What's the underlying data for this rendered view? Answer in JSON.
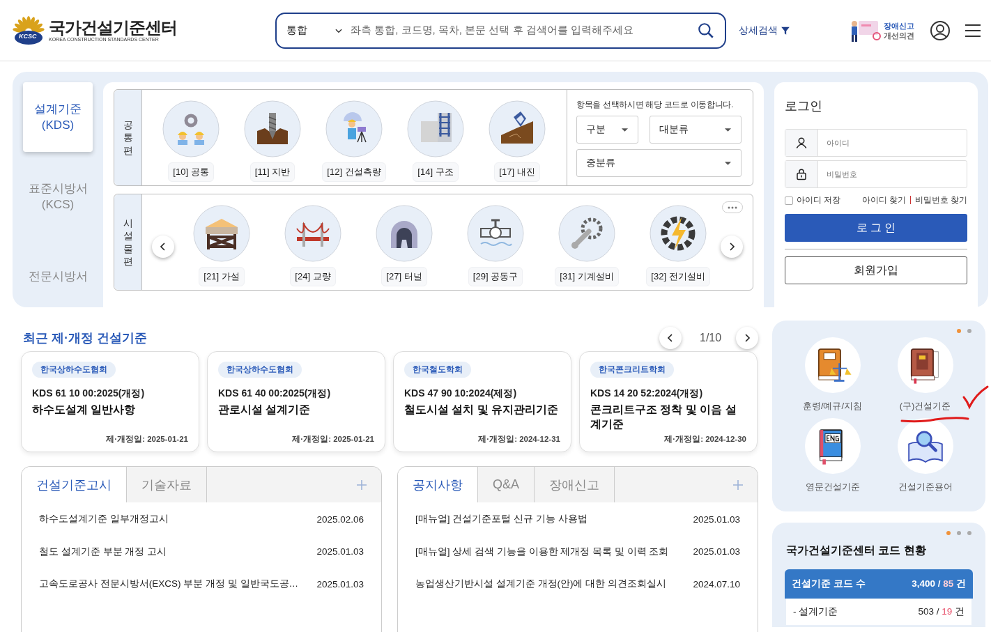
{
  "header": {
    "logo": {
      "mark": "KCSC",
      "name": "국가건설기준센터",
      "subtitle": "KOREA CONSTRUCTION STANDARDS CENTER"
    },
    "search": {
      "scope": "통합",
      "placeholder": "좌측 통합, 코드명, 목차, 본문 선택 후 검색어를 입력해주세요"
    },
    "detail_search": "상세검색",
    "report": [
      "장애신고",
      "개선의견"
    ]
  },
  "category_tabs": [
    {
      "label": "설계기준 (KDS)",
      "selected": true
    },
    {
      "label": "표준시방서 (KCS)",
      "selected": false
    },
    {
      "label": "전문시방서",
      "selected": false
    }
  ],
  "groups": [
    {
      "title": "공통편",
      "items": [
        {
          "code": "[10] 공통"
        },
        {
          "code": "[11] 지반"
        },
        {
          "code": "[12] 건설측량"
        },
        {
          "code": "[14] 구조"
        },
        {
          "code": "[17] 내진"
        }
      ]
    },
    {
      "title": "시설물편",
      "items": [
        {
          "code": "[21] 가설"
        },
        {
          "code": "[24] 교량"
        },
        {
          "code": "[27] 터널"
        },
        {
          "code": "[29] 공동구"
        },
        {
          "code": "[31] 기계설비"
        },
        {
          "code": "[32] 전기설비"
        }
      ]
    }
  ],
  "selector": {
    "hint": "항목을 선택하시면 해당 코드로 이동합니다.",
    "selects": [
      "구분",
      "대분류",
      "중분류"
    ]
  },
  "login": {
    "title": "로그인",
    "id_placeholder": "아이디",
    "pw_placeholder": "비밀번호",
    "remember": {
      "label": "아이디 저장",
      "checked": false
    },
    "links": [
      "아이디 찾기",
      "비밀번호 찾기"
    ],
    "login_button": "로 그 인",
    "join_button": "회원가입"
  },
  "recent": {
    "title": "최근 제·개정 건설기준",
    "page": "1/10",
    "cards": [
      {
        "org": "한국상하수도협회",
        "code": "KDS 61 10 00:2025(개정)",
        "title": "하수도설계 일반사항",
        "date": "제·개정일: 2025-01-21"
      },
      {
        "org": "한국상하수도협회",
        "code": "KDS 61 40 00:2025(개정)",
        "title": "관로시설 설계기준",
        "date": "제·개정일: 2025-01-21"
      },
      {
        "org": "한국철도학회",
        "code": "KDS 47 90 10:2024(제정)",
        "title": "철도시설 설치 및 유지관리기준",
        "date": "제·개정일: 2024-12-31"
      },
      {
        "org": "한국콘크리트학회",
        "code": "KDS 14 20 52:2024(개정)",
        "title": "콘크리트구조 정착 및 이음 설계기준",
        "date": "제·개정일: 2024-12-30"
      }
    ]
  },
  "boards": [
    {
      "tabs": [
        {
          "label": "건설기준고시",
          "selected": true
        },
        {
          "label": "기술자료",
          "selected": false
        }
      ],
      "rows": [
        {
          "title": "하수도설계기준 일부개정고시",
          "date": "2025.02.06"
        },
        {
          "title": "철도 설계기준 부분 개정 고시",
          "date": "2025.01.03"
        },
        {
          "title": "고속도로공사 전문시방서(EXCS) 부분 개정 및 일반국도공…",
          "date": "2025.01.03"
        }
      ]
    },
    {
      "tabs": [
        {
          "label": "공지사항",
          "selected": true
        },
        {
          "label": "Q&A",
          "selected": false
        },
        {
          "label": "장애신고",
          "selected": false
        }
      ],
      "rows": [
        {
          "title": "[매뉴얼] 건설기준포털 신규 기능 사용법",
          "date": "2025.01.03"
        },
        {
          "title": "[매뉴얼] 상세 검색 기능을 이용한 제개정 목록 및 이력 조회",
          "date": "2025.01.03"
        },
        {
          "title": "농업생산기반시설 설계기준 개정(안)에 대한 의견조회실시",
          "date": "2024.07.10"
        }
      ]
    }
  ],
  "quick_links": {
    "dots": [
      {
        "selected": true
      },
      {
        "selected": false
      }
    ],
    "items": [
      {
        "label": "훈령/예규/지침"
      },
      {
        "label": "(구)건설기준"
      },
      {
        "label": "영문건설기준"
      },
      {
        "label": "건설기준용어"
      }
    ],
    "annotations": [
      {
        "kind": "checkmark"
      },
      {
        "kind": "underline"
      }
    ]
  },
  "stats": {
    "dots": [
      {
        "selected": true
      },
      {
        "selected": false
      },
      {
        "selected": false
      }
    ],
    "title": "국가건설기준센터 코드 현황",
    "rows": [
      {
        "kind": "header",
        "label": "건설기준 코드 수",
        "total": "3,400",
        "sep": "/",
        "new": "85",
        "unit": "건"
      },
      {
        "kind": "item",
        "label": "- 설계기준",
        "total": "503",
        "sep": "/",
        "new": "19",
        "unit": "건"
      }
    ]
  }
}
